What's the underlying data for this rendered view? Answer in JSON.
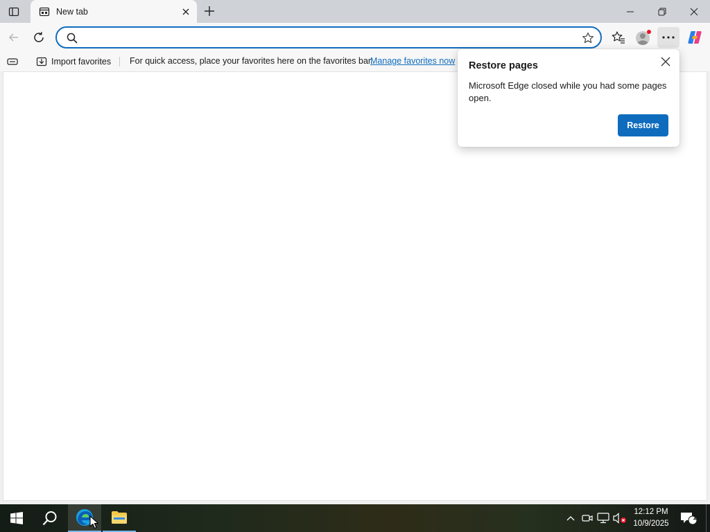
{
  "browser": {
    "tab": {
      "title": "New tab",
      "favicon": "newtab-icon"
    },
    "window_controls": [
      "minimize-icon",
      "restore-icon",
      "close-icon"
    ]
  },
  "toolbar": {
    "address": {
      "value": "",
      "placeholder": ""
    }
  },
  "favorites_bar": {
    "import_label": "Import favorites",
    "message": "For quick access, place your favorites here on the favorites bar.",
    "link_label": "Manage favorites now"
  },
  "popup": {
    "title": "Restore pages",
    "message": "Microsoft Edge closed while you had some pages open.",
    "button_label": "Restore"
  },
  "taskbar": {
    "time": "12:12 PM",
    "date": "10/9/2025",
    "notification_count": "1"
  },
  "colors": {
    "accent": "#0f6cbd",
    "titlebar": "#cfd3d8",
    "toolbar": "#f7f7f7",
    "profile_badge": "#e81123"
  }
}
